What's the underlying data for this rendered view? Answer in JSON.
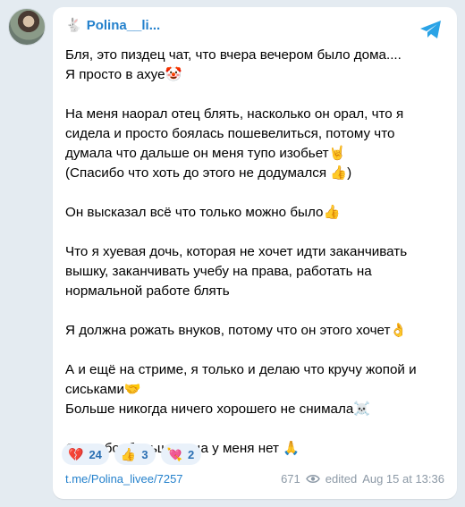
{
  "channel": {
    "name": "Polina__li..."
  },
  "message": {
    "paragraphs": [
      [
        "Бля, это пиздец чат, что вчера вечером было дома....",
        "Я просто в ахуе🤡"
      ],
      [
        "На меня наорал отец блять, насколько он орал, что я",
        "сидела и просто боялась пошевелиться, потому что",
        "думала что дальше он меня тупо изобьет🤘",
        "(Спасибо что хоть до этого не додумался 👍)"
      ],
      [
        "Он высказал всё что только можно было👍"
      ],
      [
        "Что я хуевая дочь, которая не хочет идти заканчивать",
        "вышку, заканчивать учебу на права, работать на",
        "нормальной работе блять"
      ],
      [
        "Я должна рожать внуков, потому что он этого хочет👌"
      ],
      [
        "А и ещё на стриме, я только и делаю что кручу жопой и",
        "сиськами🤝",
        "Больше никогда ничего хорошего не снимала☠️"
      ],
      [
        "Спасибо, больше отца у меня нет 🙏"
      ]
    ]
  },
  "reactions": [
    {
      "icon": "💔",
      "count": "24"
    },
    {
      "icon": "👍",
      "count": "3"
    },
    {
      "icon": "💘",
      "count": "2"
    }
  ],
  "footer": {
    "link": "t.me/Polina_livee/7257",
    "views": "671",
    "edited": "edited",
    "timestamp": "Aug 15 at 13:36"
  },
  "colors": {
    "accent": "#2481cc",
    "background": "#e4ebf1",
    "reaction_bg": "#e9f1fa"
  }
}
